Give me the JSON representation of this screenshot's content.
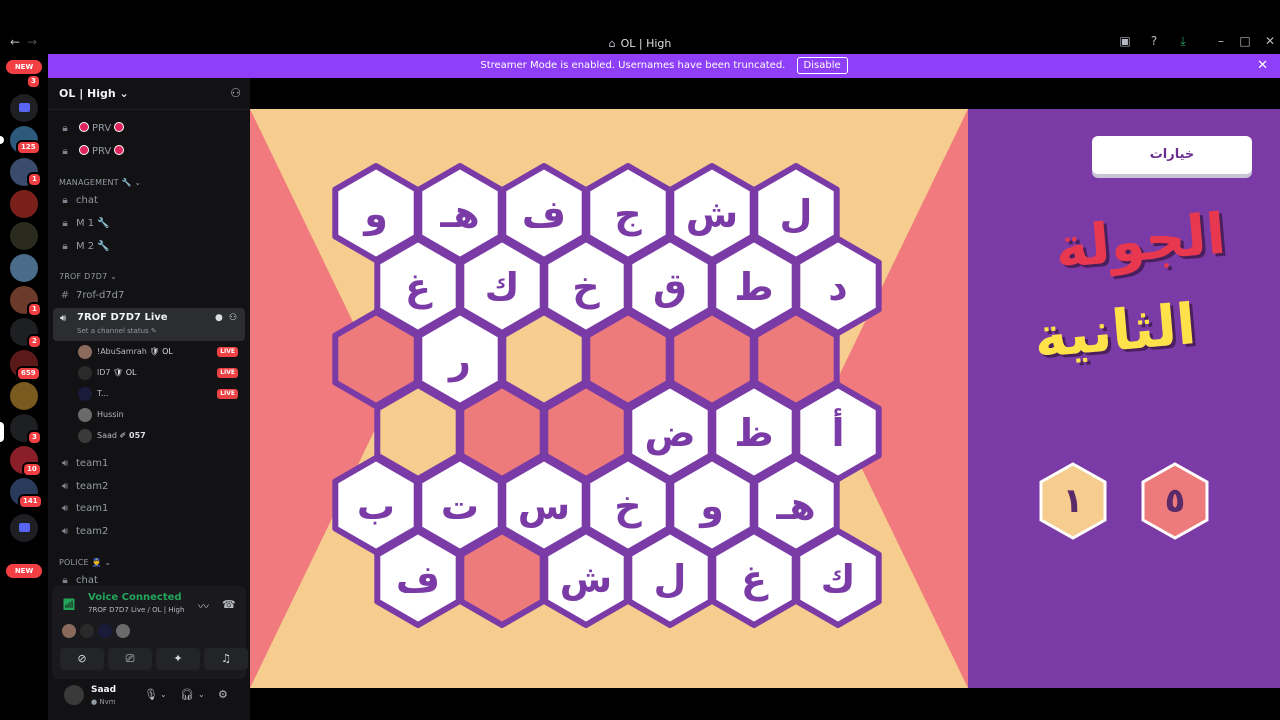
{
  "window": {
    "title": "OL | High",
    "back_icon": "←",
    "forward_icon": "→"
  },
  "banner": {
    "text": "Streamer Mode is enabled. Usernames have been truncated.",
    "disable_label": "Disable"
  },
  "rail": {
    "new_badge": "NEW",
    "counts": [
      "3",
      "125",
      "1",
      "2",
      "659",
      "1",
      "3",
      "10",
      "141"
    ]
  },
  "server": {
    "name": "OL | High",
    "channels": [
      {
        "name": "PRV"
      },
      {
        "name": "PRV"
      }
    ],
    "management_category": "MANAGEMENT 🔧",
    "management_channels": [
      "chat",
      "M 1 🔧",
      "M 2 🔧"
    ],
    "trof_category": "7ROF D7D7",
    "text_channel": "7rof-d7d7",
    "active_channel": {
      "name": "7ROF D7D7 Live",
      "status": "Set a channel status"
    },
    "voice_users": [
      {
        "name": "!AbuSamrah",
        "tag": "OL",
        "live": "LIVE"
      },
      {
        "name": "lD7",
        "tag": "OL",
        "live": "LIVE"
      },
      {
        "name": "T...",
        "tag": "",
        "live": "LIVE"
      },
      {
        "name": "Hussin",
        "tag": "",
        "live": ""
      },
      {
        "name": "Saad",
        "tag": "057",
        "live": ""
      }
    ],
    "team_channels": [
      "team1",
      "team2",
      "team1",
      "team2"
    ],
    "police_category": "POLICE 👮",
    "police_channel": "chat"
  },
  "voice": {
    "title": "Voice Connected",
    "subtitle": "7ROF D7D7 Live / OL | High"
  },
  "user": {
    "name": "Saad",
    "status": "Nvm"
  },
  "game": {
    "options_label": "خيارات",
    "round_line1": "الجولة",
    "round_line2": "الثانية",
    "score_yellow": "١",
    "score_red": "٥",
    "colors": {
      "white": "#ffffff",
      "red": "#ee7b7c",
      "yellow": "#f6cd8e",
      "purple": "#7a3ba6",
      "corner_red": "#f07a7d"
    },
    "rows": [
      [
        {
          "t": "و",
          "c": "white"
        },
        {
          "t": "هـ",
          "c": "white"
        },
        {
          "t": "ف",
          "c": "white"
        },
        {
          "t": "ج",
          "c": "white"
        },
        {
          "t": "ش",
          "c": "white"
        },
        {
          "t": "ل",
          "c": "white"
        }
      ],
      [
        {
          "t": "غ",
          "c": "white"
        },
        {
          "t": "ك",
          "c": "white"
        },
        {
          "t": "خ",
          "c": "white"
        },
        {
          "t": "ق",
          "c": "white"
        },
        {
          "t": "ط",
          "c": "white"
        },
        {
          "t": "د",
          "c": "white"
        }
      ],
      [
        {
          "t": "",
          "c": "red"
        },
        {
          "t": "ر",
          "c": "white"
        },
        {
          "t": "",
          "c": "yellow"
        },
        {
          "t": "",
          "c": "red"
        },
        {
          "t": "",
          "c": "red"
        },
        {
          "t": "",
          "c": "red"
        }
      ],
      [
        {
          "t": "",
          "c": "yellow"
        },
        {
          "t": "",
          "c": "red"
        },
        {
          "t": "",
          "c": "red"
        },
        {
          "t": "ض",
          "c": "white"
        },
        {
          "t": "ظ",
          "c": "white"
        },
        {
          "t": "أ",
          "c": "white"
        }
      ],
      [
        {
          "t": "ب",
          "c": "white"
        },
        {
          "t": "ت",
          "c": "white"
        },
        {
          "t": "س",
          "c": "white"
        },
        {
          "t": "خ",
          "c": "white"
        },
        {
          "t": "و",
          "c": "white"
        },
        {
          "t": "هـ",
          "c": "white"
        }
      ],
      [
        {
          "t": "ف",
          "c": "white"
        },
        {
          "t": "",
          "c": "red"
        },
        {
          "t": "ش",
          "c": "white"
        },
        {
          "t": "ل",
          "c": "white"
        },
        {
          "t": "غ",
          "c": "white"
        },
        {
          "t": "ك",
          "c": "white"
        }
      ]
    ]
  }
}
